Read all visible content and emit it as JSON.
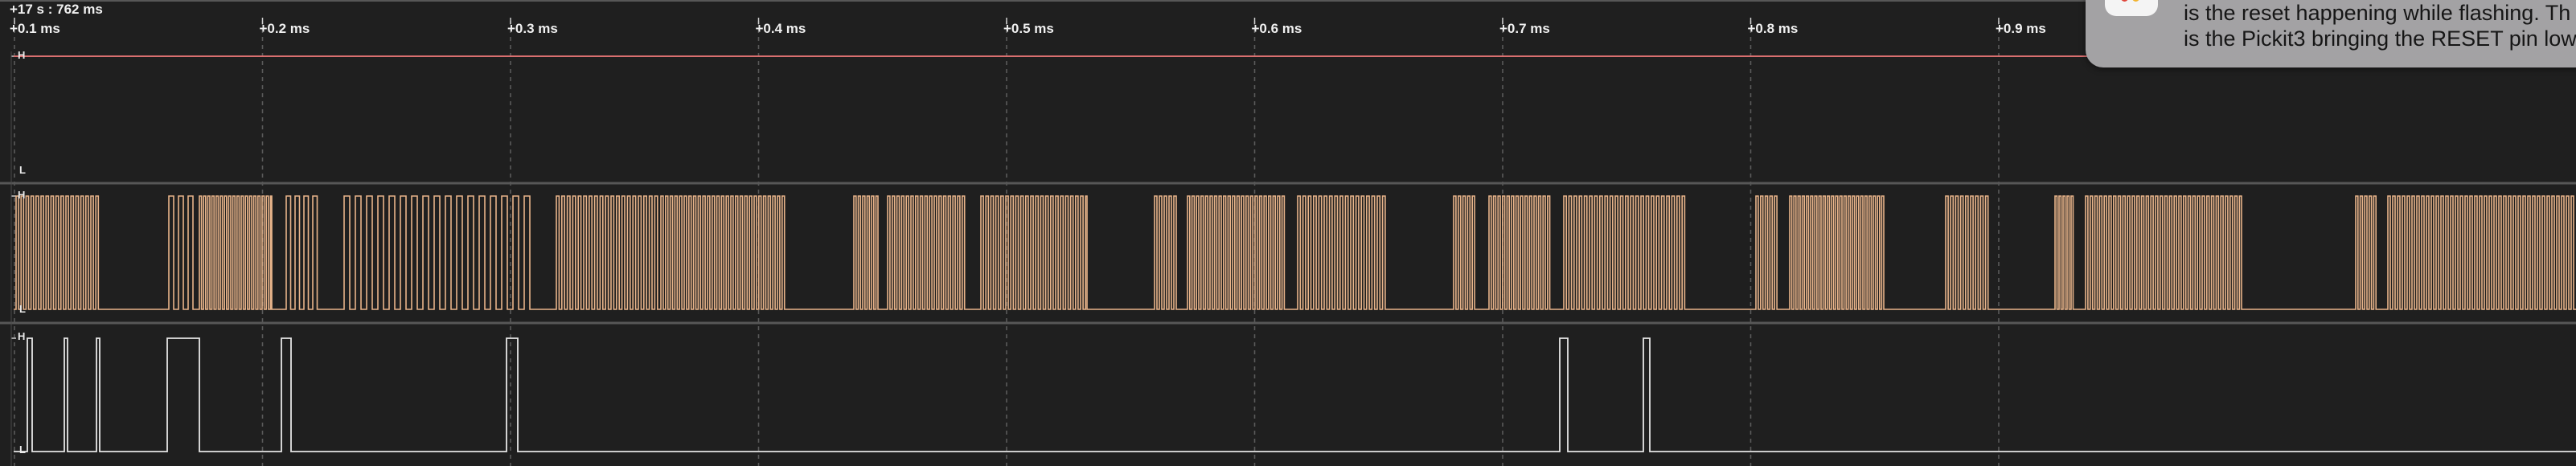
{
  "time_origin": "+17 s : 762 ms",
  "time_ticks": [
    "+0.1 ms",
    "+0.2 ms",
    "+0.3 ms",
    "+0.4 ms",
    "+0.5 ms",
    "+0.6 ms",
    "+0.7 ms",
    "+0.8 ms",
    "+0.9 ms"
  ],
  "channels": [
    {
      "high_label": "H",
      "low_label": "L",
      "color": "#d96f6f"
    },
    {
      "high_label": "H",
      "low_label": "L",
      "color": "#e8b48a"
    },
    {
      "high_label": "H",
      "low_label": "L",
      "color": "#e6e6e6"
    }
  ],
  "notification": {
    "line1": "is the reset happening while flashing. Th",
    "line2": "is the Pickit3 bringing the RESET pin low",
    "app_icon": "app-icon"
  },
  "colors": {
    "background": "#1f1f1f",
    "grid_dashed": "#5a5a5a",
    "separator": "#575757",
    "notification_bg": "#a3a2a4"
  }
}
